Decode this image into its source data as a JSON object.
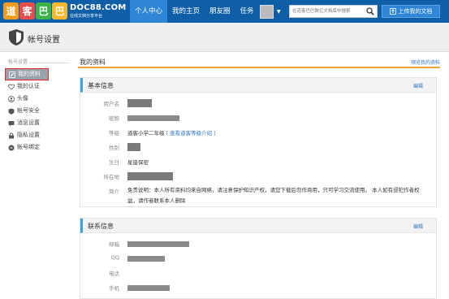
{
  "logo": {
    "chars": [
      "道",
      "客",
      "巴",
      "巴"
    ],
    "colors": [
      "#f29b1c",
      "#e54d4d",
      "#3cb34a",
      "#f7b829"
    ]
  },
  "brand": {
    "name": "DOC88.COM",
    "slogan": "在线文档分享平台"
  },
  "nav": {
    "items": [
      "个人中心",
      "我的主页",
      "朋友圈",
      "任务"
    ]
  },
  "search": {
    "placeholder": "在道客巴巴数亿文档库中搜索"
  },
  "upload": {
    "label": "上传我的文档"
  },
  "titlebar": {
    "title": "帐号设置"
  },
  "sidebar": {
    "header": "帐号设置",
    "items": [
      "我的资料",
      "我的认证",
      "头像",
      "帐号安全",
      "消息设置",
      "隐私设置",
      "帐号绑定"
    ]
  },
  "main": {
    "title": "我的资料",
    "preview_link": "预览我的资料"
  },
  "basic": {
    "title": "基本信息",
    "edit": "编辑",
    "labels": {
      "username": "用户名",
      "nickname": "昵称",
      "level": "等级",
      "gender": "性别",
      "birthday": "生日",
      "location": "所在地",
      "intro": "简介"
    },
    "level_value": "道客小学二年级",
    "level_link": "( 查看道客等级介绍 )",
    "birthday_value": "星座保密",
    "intro_value": "免责说明：本人所有资料均来自网络，请注意保护知识产权，请您下载后勿作商用，只可学习交流使用。 本人如有侵犯作者权益，请作者联系本人删除"
  },
  "contact": {
    "title": "联系信息",
    "edit": "编辑",
    "labels": {
      "email": "邮箱",
      "qq": "QQ",
      "phone": "电话",
      "mobile": "手机"
    }
  }
}
